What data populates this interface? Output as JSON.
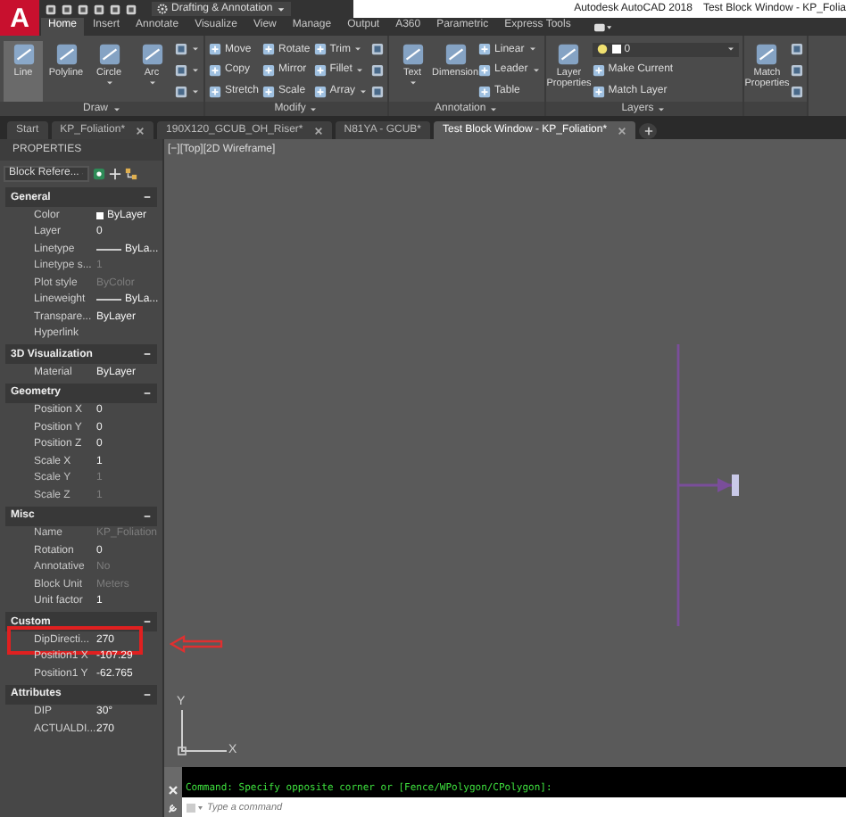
{
  "app_button": {
    "label": "A"
  },
  "quick_access": {
    "workspace": "Drafting & Annotation"
  },
  "window": {
    "app_name": "Autodesk AutoCAD 2018",
    "title": "Test Block Window - KP_Folia"
  },
  "ribbon_tabs": [
    {
      "label": "Home",
      "selected": true
    },
    {
      "label": "Insert",
      "selected": false
    },
    {
      "label": "Annotate",
      "selected": false
    },
    {
      "label": "Visualize",
      "selected": false
    },
    {
      "label": "View",
      "selected": false
    },
    {
      "label": "Manage",
      "selected": false
    },
    {
      "label": "Output",
      "selected": false
    },
    {
      "label": "A360",
      "selected": false
    },
    {
      "label": "Parametric",
      "selected": false
    },
    {
      "label": "Express Tools",
      "selected": false
    }
  ],
  "panels": [
    {
      "label": "Draw",
      "columns": [
        [
          {
            "kind": "large",
            "label": "Line",
            "selected": true,
            "dropdown": false
          }
        ],
        [
          {
            "kind": "large",
            "label": "Polyline",
            "selected": false,
            "dropdown": false
          }
        ],
        [
          {
            "kind": "large",
            "label": "Circle",
            "selected": false,
            "dropdown": true
          }
        ],
        [
          {
            "kind": "large",
            "label": "Arc",
            "selected": false,
            "dropdown": true
          }
        ],
        [
          {
            "kind": "icon",
            "dropdown": true
          },
          {
            "kind": "icon",
            "dropdown": true
          },
          {
            "kind": "icon",
            "dropdown": true
          }
        ]
      ]
    },
    {
      "label": "Modify",
      "columns": [
        [
          {
            "kind": "small",
            "label": "Move",
            "dropdown": false
          },
          {
            "kind": "small",
            "label": "Copy",
            "dropdown": false
          },
          {
            "kind": "small",
            "label": "Stretch",
            "dropdown": false
          }
        ],
        [
          {
            "kind": "small",
            "label": "Rotate",
            "dropdown": false
          },
          {
            "kind": "small",
            "label": "Mirror",
            "dropdown": false
          },
          {
            "kind": "small",
            "label": "Scale",
            "dropdown": false
          }
        ],
        [
          {
            "kind": "small",
            "label": "Trim",
            "dropdown": true
          },
          {
            "kind": "small",
            "label": "Fillet",
            "dropdown": true
          },
          {
            "kind": "small",
            "label": "Array",
            "dropdown": true
          }
        ],
        [
          {
            "kind": "icon",
            "dropdown": false
          },
          {
            "kind": "icon",
            "dropdown": false
          },
          {
            "kind": "icon",
            "dropdown": false
          }
        ]
      ]
    },
    {
      "label": "Annotation",
      "columns": [
        [
          {
            "kind": "large",
            "label": "Text",
            "selected": false,
            "dropdown": true
          }
        ],
        [
          {
            "kind": "large",
            "label": "Dimension",
            "selected": false,
            "dropdown": false
          }
        ],
        [
          {
            "kind": "small",
            "label": "Linear",
            "dropdown": true
          },
          {
            "kind": "small",
            "label": "Leader",
            "dropdown": true
          },
          {
            "kind": "small",
            "label": "Table",
            "dropdown": false
          }
        ]
      ]
    },
    {
      "label": "Layers",
      "columns": [
        [
          {
            "kind": "large",
            "label": "Layer Properties",
            "selected": false,
            "dropdown": false
          }
        ],
        [
          {
            "kind": "select",
            "value": "0"
          },
          {
            "kind": "small",
            "label": "Make Current",
            "dropdown": false
          },
          {
            "kind": "small",
            "label": "Match Layer",
            "dropdown": false
          }
        ]
      ]
    },
    {
      "columns": [
        [
          {
            "kind": "large",
            "label": "Match Properties",
            "selected": false,
            "dropdown": false
          }
        ],
        [
          {
            "kind": "icon",
            "dropdown": false
          },
          {
            "kind": "icon",
            "dropdown": false
          },
          {
            "kind": "icon",
            "dropdown": false
          }
        ]
      ]
    }
  ],
  "file_tabs": [
    {
      "label": "Start",
      "selected": false,
      "closable": false
    },
    {
      "label": "KP_Foliation*",
      "selected": false,
      "closable": true
    },
    {
      "label": "190X120_GCUB_OH_Riser*",
      "selected": false,
      "closable": true
    },
    {
      "label": "N81YA - GCUB*",
      "selected": false,
      "closable": false
    },
    {
      "label": "Test Block Window - KP_Foliation*",
      "selected": true,
      "closable": true
    }
  ],
  "properties": {
    "title": "PROPERTIES",
    "selection": "Block Refere...",
    "sections": [
      {
        "title": "General",
        "expanded": true,
        "rows": [
          {
            "label": "Color",
            "value": "ByLayer",
            "kind": "color",
            "disabled": false
          },
          {
            "label": "Layer",
            "value": "0",
            "kind": "text",
            "disabled": false
          },
          {
            "label": "Linetype",
            "value": "ByLa...",
            "kind": "line",
            "disabled": false
          },
          {
            "label": "Linetype s...",
            "value": "1",
            "kind": "text",
            "disabled": true
          },
          {
            "label": "Plot style",
            "value": "ByColor",
            "kind": "text",
            "disabled": true
          },
          {
            "label": "Lineweight",
            "value": "ByLa...",
            "kind": "line",
            "disabled": false
          },
          {
            "label": "Transpare...",
            "value": "ByLayer",
            "kind": "text",
            "disabled": false
          },
          {
            "label": "Hyperlink",
            "kind": "text"
          }
        ]
      },
      {
        "title": "3D Visualization",
        "expanded": true,
        "rows": [
          {
            "label": "Material",
            "value": "ByLayer",
            "kind": "text",
            "disabled": false
          }
        ]
      },
      {
        "title": "Geometry",
        "expanded": true,
        "rows": [
          {
            "label": "Position X",
            "value": "0",
            "kind": "text",
            "disabled": false
          },
          {
            "label": "Position Y",
            "value": "0",
            "kind": "text",
            "disabled": false
          },
          {
            "label": "Position Z",
            "value": "0",
            "kind": "text",
            "disabled": false
          },
          {
            "label": "Scale X",
            "value": "1",
            "kind": "text",
            "disabled": false
          },
          {
            "label": "Scale Y",
            "value": "1",
            "kind": "text",
            "disabled": true
          },
          {
            "label": "Scale Z",
            "value": "1",
            "kind": "text",
            "disabled": true
          }
        ]
      },
      {
        "title": "Misc",
        "expanded": true,
        "rows": [
          {
            "label": "Name",
            "value": "KP_Foliation",
            "kind": "text",
            "disabled": true
          },
          {
            "label": "Rotation",
            "value": "0",
            "kind": "text",
            "disabled": false
          },
          {
            "label": "Annotative",
            "value": "No",
            "kind": "text",
            "disabled": true
          },
          {
            "label": "Block Unit",
            "value": "Meters",
            "kind": "text",
            "disabled": true
          },
          {
            "label": "Unit factor",
            "value": "1",
            "kind": "text",
            "disabled": false
          }
        ]
      },
      {
        "title": "Custom",
        "expanded": true,
        "rows": [
          {
            "label": "DipDirecti...",
            "value": "270",
            "kind": "text",
            "disabled": false,
            "highlighted": true
          },
          {
            "label": "Position1 X",
            "value": "-107.29",
            "kind": "text",
            "disabled": false,
            "highlighted": false
          },
          {
            "label": "Position1 Y",
            "value": "-62.765",
            "kind": "text",
            "disabled": false,
            "highlighted": false
          }
        ]
      },
      {
        "title": "Attributes",
        "expanded": true,
        "rows": [
          {
            "label": "DIP",
            "value": "30°",
            "kind": "text",
            "disabled": false
          },
          {
            "label": "ACTUALDI...",
            "value": "270",
            "kind": "text",
            "disabled": false
          }
        ]
      }
    ]
  },
  "viewport": {
    "label": "[−][Top][2D Wireframe]",
    "ucs": {
      "y_label": "Y",
      "x_label": "X"
    }
  },
  "command_line": {
    "history": "Command: Specify opposite corner or [Fence/WPolygon/CPolygon]:",
    "placeholder": "Type a command"
  }
}
